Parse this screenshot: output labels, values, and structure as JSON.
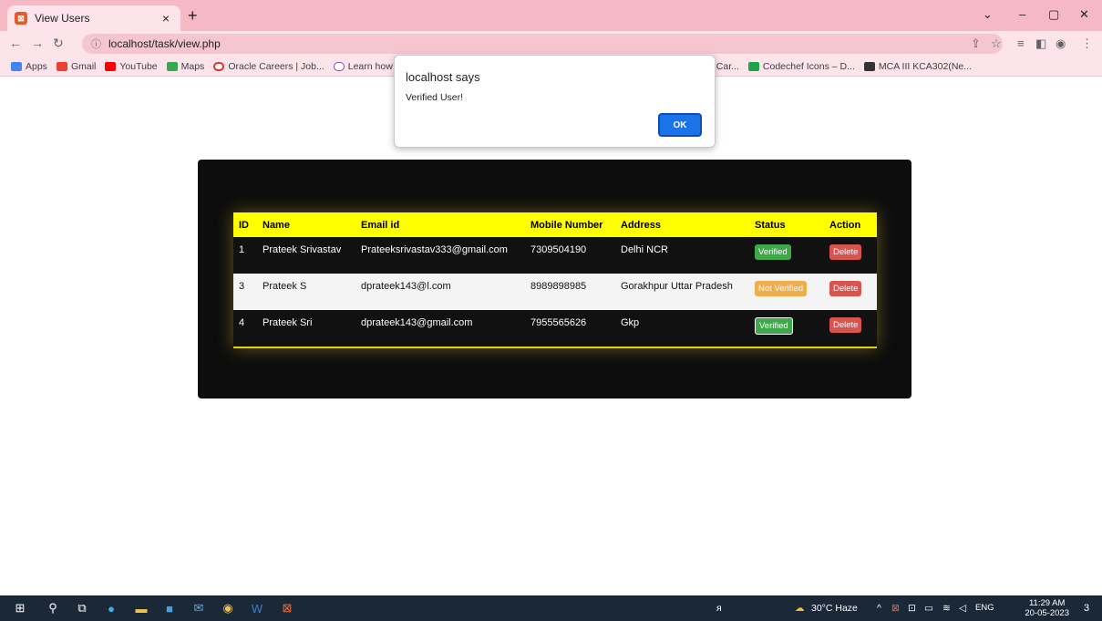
{
  "browser": {
    "tab_title": "View Users",
    "tab_close": "×",
    "new_tab": "+",
    "url": "localhost/task/view.php",
    "bookmarks": [
      "Apps",
      "Gmail",
      "YouTube",
      "Maps",
      "Oracle Careers | Job...",
      "Learn how",
      "Car...",
      "Codechef Icons – D...",
      "MCA III KCA302(Ne..."
    ]
  },
  "dialog": {
    "title": "localhost says",
    "message": "Verified User!",
    "ok_label": "OK"
  },
  "table": {
    "headers": [
      "ID",
      "Name",
      "Email id",
      "Mobile Number",
      "Address",
      "Status",
      "Action"
    ],
    "rows": [
      {
        "id": "1",
        "name": "Prateek Srivastav",
        "email": "Prateeksrivastav333@gmail.com",
        "mobile": "7309504190",
        "address": "Delhi NCR",
        "status": "Verified",
        "action": "Delete"
      },
      {
        "id": "3",
        "name": "Prateek S",
        "email": "dprateek143@l.com",
        "mobile": "8989898985",
        "address": "Gorakhpur Uttar Pradesh",
        "status": "Not Verified",
        "action": "Delete"
      },
      {
        "id": "4",
        "name": "Prateek Sri",
        "email": "dprateek143@gmail.com",
        "mobile": "7955565626",
        "address": "Gkp",
        "status": "Verified",
        "action": "Delete"
      }
    ]
  },
  "taskbar": {
    "weather": "30°C Haze",
    "lang": "ENG",
    "time": "11:29 AM",
    "date": "20-05-2023",
    "notification_count": "3"
  },
  "colors": {
    "header_yellow": "#ffff00",
    "verified_green": "#3ea84a",
    "not_verified_orange": "#f0ad4e",
    "delete_red": "#d9534f"
  }
}
